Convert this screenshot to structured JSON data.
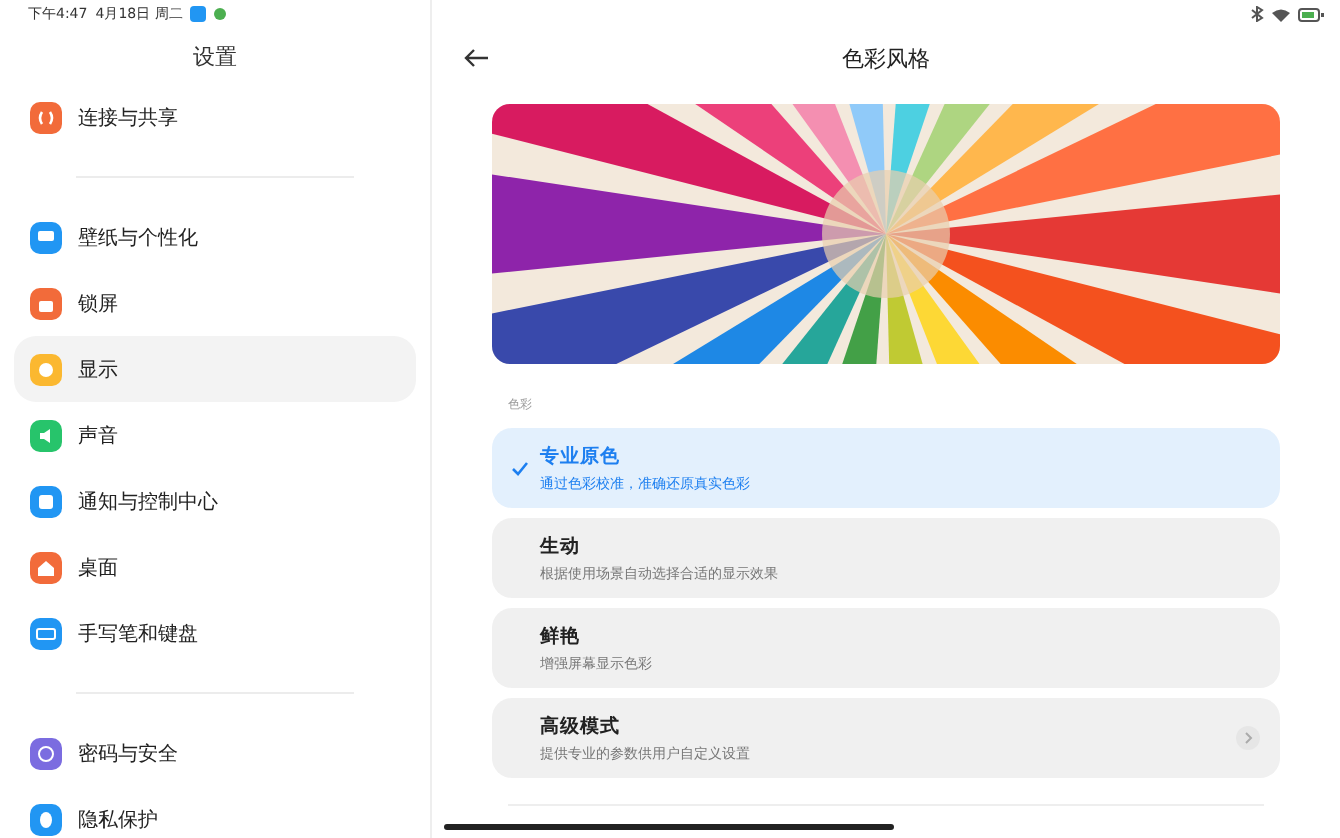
{
  "status_bar": {
    "time": "下午4:47",
    "date": "4月18日 周二"
  },
  "sidebar": {
    "title": "设置",
    "groups": [
      [
        {
          "label": "连接与共享",
          "color": "#f26b3a",
          "selected": false
        }
      ],
      [
        {
          "label": "壁纸与个性化",
          "color": "#2196f3",
          "selected": false
        },
        {
          "label": "锁屏",
          "color": "#f26b3a",
          "selected": false
        },
        {
          "label": "显示",
          "color": "#fbb830",
          "selected": true
        },
        {
          "label": "声音",
          "color": "#27c46b",
          "selected": false
        },
        {
          "label": "通知与控制中心",
          "color": "#2196f3",
          "selected": false
        },
        {
          "label": "桌面",
          "color": "#f26b3a",
          "selected": false
        },
        {
          "label": "手写笔和键盘",
          "color": "#2196f3",
          "selected": false
        }
      ],
      [
        {
          "label": "密码与安全",
          "color": "#7b6ce0",
          "selected": false
        },
        {
          "label": "隐私保护",
          "color": "#2196f3",
          "selected": false
        }
      ]
    ]
  },
  "page": {
    "title": "色彩风格",
    "section_label": "色彩",
    "options": [
      {
        "kind": "choice",
        "title": "专业原色",
        "subtitle": "通过色彩校准，准确还原真实色彩",
        "selected": true
      },
      {
        "kind": "choice",
        "title": "生动",
        "subtitle": "根据使用场景自动选择合适的显示效果",
        "selected": false
      },
      {
        "kind": "choice",
        "title": "鲜艳",
        "subtitle": "增强屏幕显示色彩",
        "selected": false
      },
      {
        "kind": "link",
        "title": "高级模式",
        "subtitle": "提供专业的参数供用户自定义设置"
      }
    ]
  }
}
